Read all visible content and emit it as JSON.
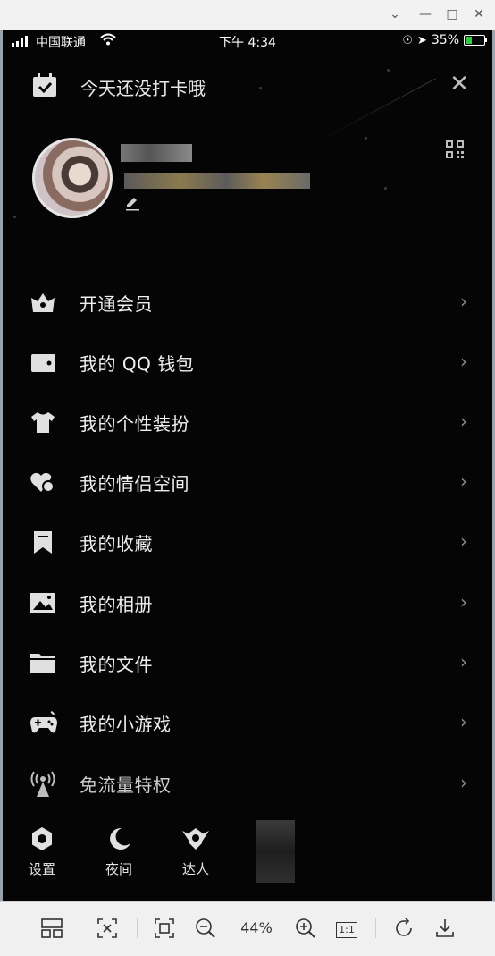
{
  "window": {
    "controls": [
      "chevron-down",
      "minimize",
      "maximize",
      "close"
    ]
  },
  "status_bar": {
    "carrier": "中国联通",
    "time": "下午 4:34",
    "battery_text": "35%",
    "battery_level": 0.35,
    "battery_color": "#2ecc40"
  },
  "checkin": {
    "text": "今天还没打卡哦"
  },
  "menu": {
    "items": [
      {
        "label": "开通会员",
        "icon": "vip-crown-icon"
      },
      {
        "label": "我的 QQ 钱包",
        "icon": "wallet-icon"
      },
      {
        "label": "我的个性装扮",
        "icon": "shirt-icon"
      },
      {
        "label": "我的情侣空间",
        "icon": "couple-heart-icon"
      },
      {
        "label": "我的收藏",
        "icon": "bookmark-icon"
      },
      {
        "label": "我的相册",
        "icon": "photo-icon"
      },
      {
        "label": "我的文件",
        "icon": "folder-icon"
      },
      {
        "label": "我的小游戏",
        "icon": "gamepad-icon"
      },
      {
        "label": "免流量特权",
        "icon": "signal-tower-icon"
      }
    ]
  },
  "bottom_nav": {
    "settings": "设置",
    "night": "夜间",
    "expert": "达人"
  },
  "toolbar": {
    "zoom": "44%",
    "ratio": "1:1"
  },
  "colors": {
    "background": "#050505",
    "text": "#f0f0f0",
    "icon": "#e0e0e0",
    "chevron": "#8c8c8c"
  }
}
